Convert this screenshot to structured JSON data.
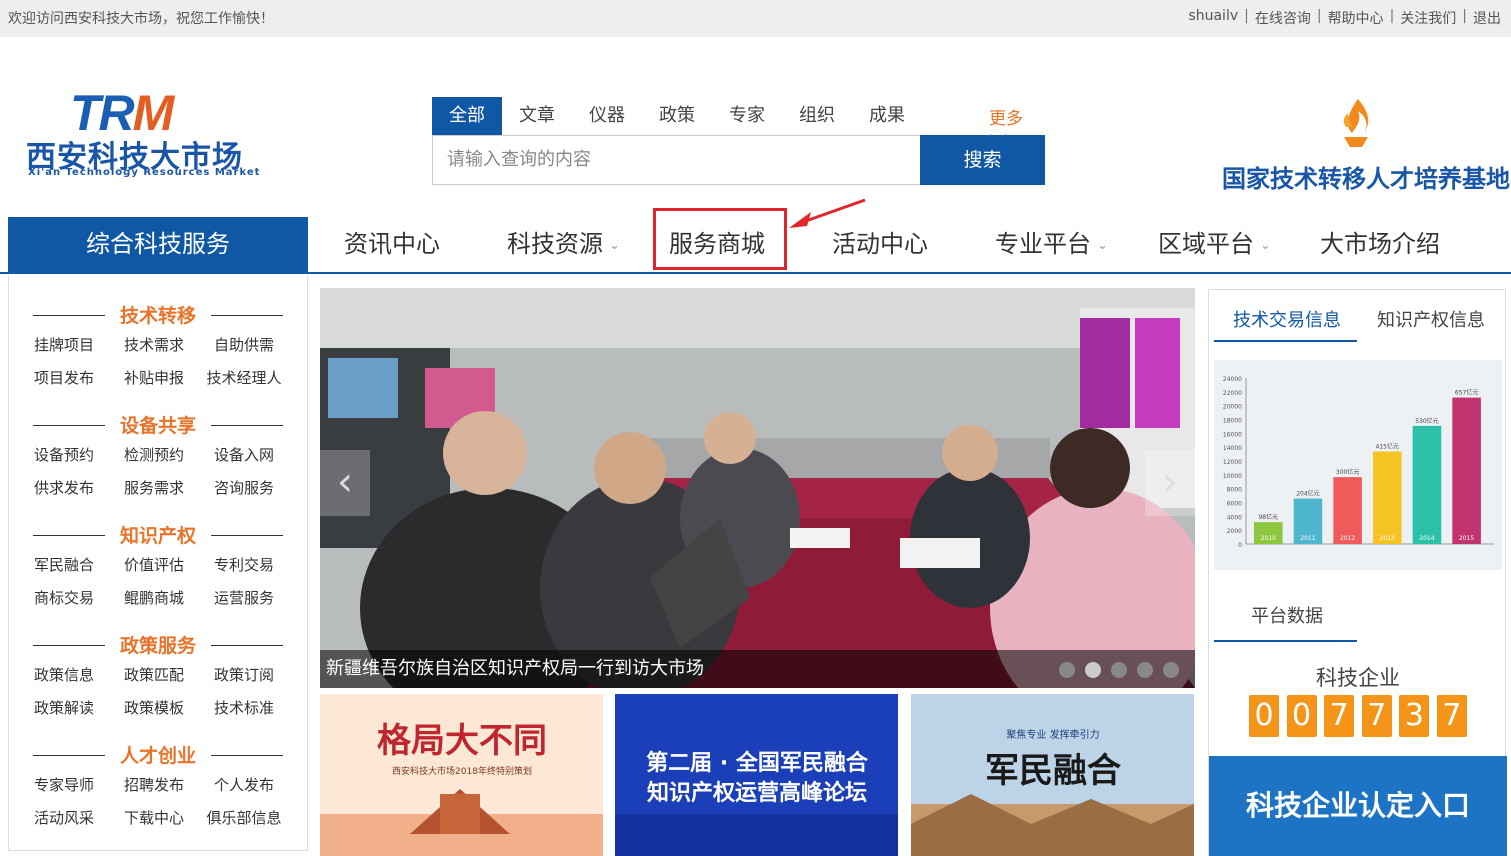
{
  "topbar": {
    "welcome": "欢迎访问西安科技大市场，祝您工作愉快！",
    "user": "shuailv",
    "links": [
      "在线咨询",
      "帮助中心",
      "关注我们",
      "退出"
    ]
  },
  "logo": {
    "abbr": "TR",
    "abbr_m": "M",
    "name_cn": "西安科技大市场",
    "name_en": "Xi'an Technology Resources Market"
  },
  "search": {
    "tabs": [
      "全部",
      "文章",
      "仪器",
      "政策",
      "专家",
      "组织",
      "成果"
    ],
    "more": "更多>>",
    "placeholder": "请输入查询的内容",
    "button": "搜索"
  },
  "badge": {
    "text": "国家技术转移人才培养基地"
  },
  "nav": {
    "main": "综合科技服务",
    "items": [
      "资讯中心",
      "科技资源",
      "服务商城",
      "活动中心",
      "专业平台",
      "区域平台",
      "大市场介绍"
    ]
  },
  "sidebar": {
    "sections": [
      {
        "title": "技术转移",
        "items": [
          "挂牌项目",
          "技术需求",
          "自助供需",
          "项目发布",
          "补贴申报",
          "技术经理人"
        ]
      },
      {
        "title": "设备共享",
        "items": [
          "设备预约",
          "检测预约",
          "设备入网",
          "供求发布",
          "服务需求",
          "咨询服务"
        ]
      },
      {
        "title": "知识产权",
        "items": [
          "军民融合",
          "价值评估",
          "专利交易",
          "商标交易",
          "鲲鹏商城",
          "运营服务"
        ]
      },
      {
        "title": "政策服务",
        "items": [
          "政策信息",
          "政策匹配",
          "政策订阅",
          "政策解读",
          "政策模板",
          "技术标准"
        ]
      },
      {
        "title": "人才创业",
        "items": [
          "专家导师",
          "招聘发布",
          "个人发布",
          "活动风采",
          "下载中心",
          "俱乐部信息"
        ]
      }
    ]
  },
  "slider": {
    "caption": "新疆维吾尔族自治区知识产权局一行到访大市场",
    "prev": "‹",
    "next": "›"
  },
  "thumbs": [
    {
      "title": "格局大不同",
      "subtitle": "西安科技大市场2018年终特别策划"
    },
    {
      "title_line1": "第二届 · 全国军民融合",
      "title_line2": "知识产权运营高峰论坛"
    },
    {
      "title": "军民融合",
      "subtitle": "聚焦专业  发挥牵引力"
    }
  ],
  "right_panel": {
    "tabs": [
      "技术交易信息",
      "知识产权信息"
    ],
    "section": "平台数据",
    "count_label": "科技企业",
    "digits": [
      "0",
      "0",
      "7",
      "7",
      "3",
      "7"
    ],
    "entry": "科技企业认定入口"
  },
  "chart_data": {
    "type": "bar",
    "categories": [
      "2010",
      "2011",
      "2012",
      "2013",
      "2014",
      "2015"
    ],
    "values": [
      98,
      204,
      300,
      415,
      530,
      657
    ],
    "data_labels": [
      "98亿元",
      "204亿元",
      "300亿元",
      "415亿元",
      "530亿元",
      "657亿元"
    ],
    "yticks": [
      "0",
      "2000",
      "4000",
      "6000",
      "8000",
      "10000",
      "12000",
      "14000",
      "16000",
      "18000",
      "20000",
      "22000",
      "24000"
    ],
    "colors": [
      "#8dc63f",
      "#4fb6d0",
      "#ef5b5b",
      "#f6c325",
      "#2bc1a8",
      "#c2346f"
    ],
    "ylim": [
      0,
      700
    ]
  }
}
